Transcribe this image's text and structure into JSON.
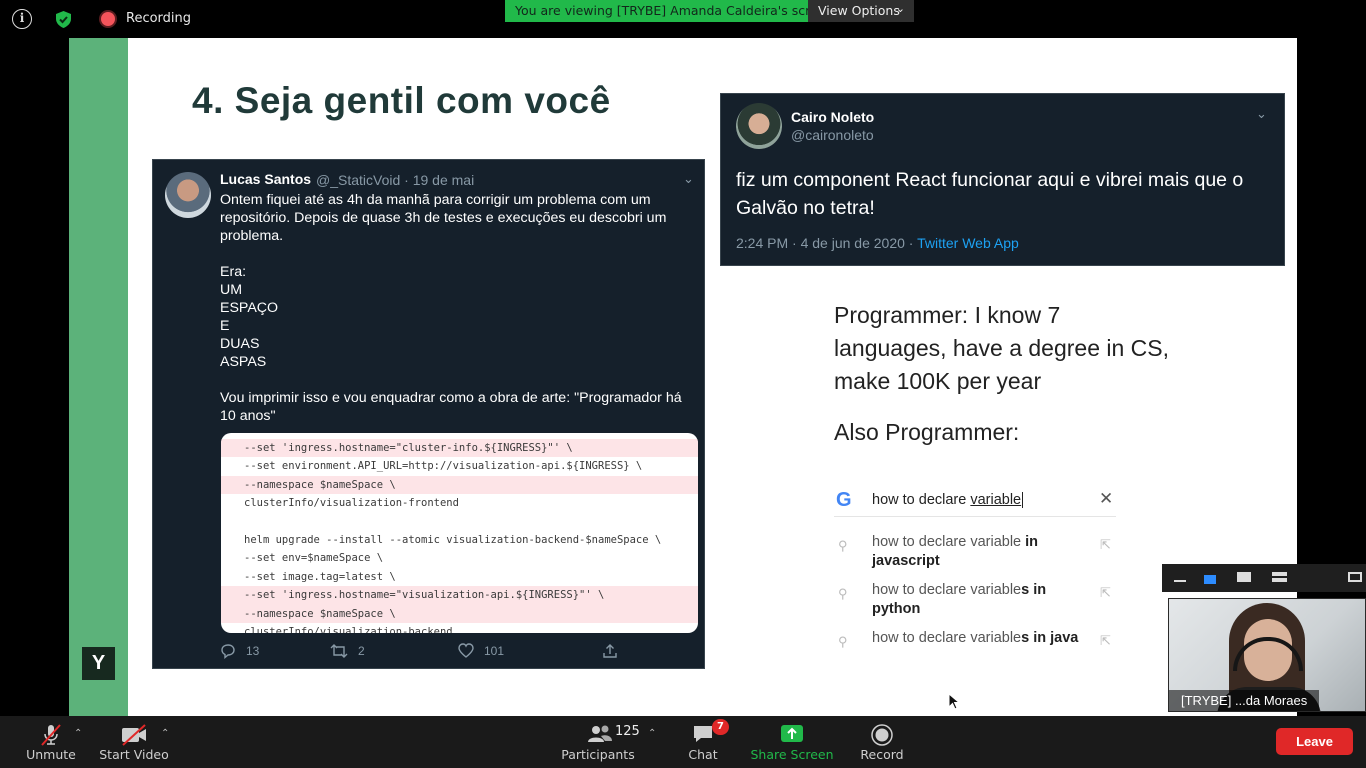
{
  "topbar": {
    "info_icon": "info-icon",
    "shield_icon": "shield-check-icon",
    "recording_label": "Recording",
    "viewing_banner": "You are viewing [TRYBE] Amanda Caldeira's screen",
    "view_options_label": "View Options",
    "colors": {
      "banner": "#21b94a",
      "record_dot": "#f4545b"
    }
  },
  "slide": {
    "title": "4. Seja gentil com você",
    "logo_letter": "Y",
    "accent_color": "#5cb27a",
    "tweet1": {
      "name": "Lucas Santos",
      "handle_date": "@_StaticVoid · 19 de mai",
      "text": "Ontem fiquei até as 4h da manhã para corrigir um problema com um repositório. Depois de quase 3h de testes e execuções eu descobri um problema.\n\nEra:\nUM\nESPAÇO\nE\nDUAS\nASPAS\n\nVou imprimir isso e vou enquadrar como a obra de arte: \"Programador há 10 anos\"",
      "code_lines": [
        {
          "text": "--set 'ingress.hostname=\"cluster-info.${INGRESS}\"' \\",
          "highlight": true
        },
        {
          "text": "--set environment.API_URL=http://visualization-api.${INGRESS} \\",
          "highlight": false
        },
        {
          "text": "--namespace $nameSpace \\",
          "highlight": true
        },
        {
          "text": "clusterInfo/visualization-frontend",
          "highlight": false
        },
        {
          "text": "",
          "highlight": false
        },
        {
          "text": "helm upgrade --install --atomic visualization-backend-$nameSpace \\",
          "highlight": false
        },
        {
          "text": "--set env=$nameSpace \\",
          "highlight": false
        },
        {
          "text": "--set image.tag=latest \\",
          "highlight": false
        },
        {
          "text": "--set 'ingress.hostname=\"visualization-api.${INGRESS}\"' \\",
          "highlight": true
        },
        {
          "text": "--namespace $nameSpace \\",
          "highlight": true
        },
        {
          "text": "clusterInfo/visualization-backend",
          "highlight": false
        }
      ],
      "replies": "13",
      "retweets": "2",
      "likes": "101"
    },
    "tweet2": {
      "name": "Cairo Noleto",
      "handle": "@caironoleto",
      "text": "fiz um component React funcionar aqui e vibrei mais que o Galvão no tetra!",
      "time": "2:24 PM · 4 de jun de 2020 · ",
      "app": "Twitter Web App"
    },
    "meme": {
      "statement": "Programmer: I know 7 languages, have a degree in CS, make 100K per year",
      "also": "Also Programmer:",
      "google_letter": "G",
      "query_prefix": "how to declare ",
      "query_underlined": "variable",
      "suggestions": [
        {
          "normal": "how to declare variable",
          "bold": " in javascript"
        },
        {
          "normal": "how to declare variable",
          "bold": "s in python"
        },
        {
          "normal": "how to declare variable",
          "bold": "s in java"
        }
      ]
    }
  },
  "participant": {
    "name": "[TRYBE] ...da Moraes"
  },
  "toolbar": {
    "unmute": "Unmute",
    "start_video": "Start Video",
    "participants_count": "125",
    "participants": "Participants",
    "chat": "Chat",
    "chat_badge": "7",
    "share_screen": "Share Screen",
    "record": "Record",
    "leave": "Leave",
    "colors": {
      "share": "#21b94a",
      "leave": "#e02828"
    }
  }
}
